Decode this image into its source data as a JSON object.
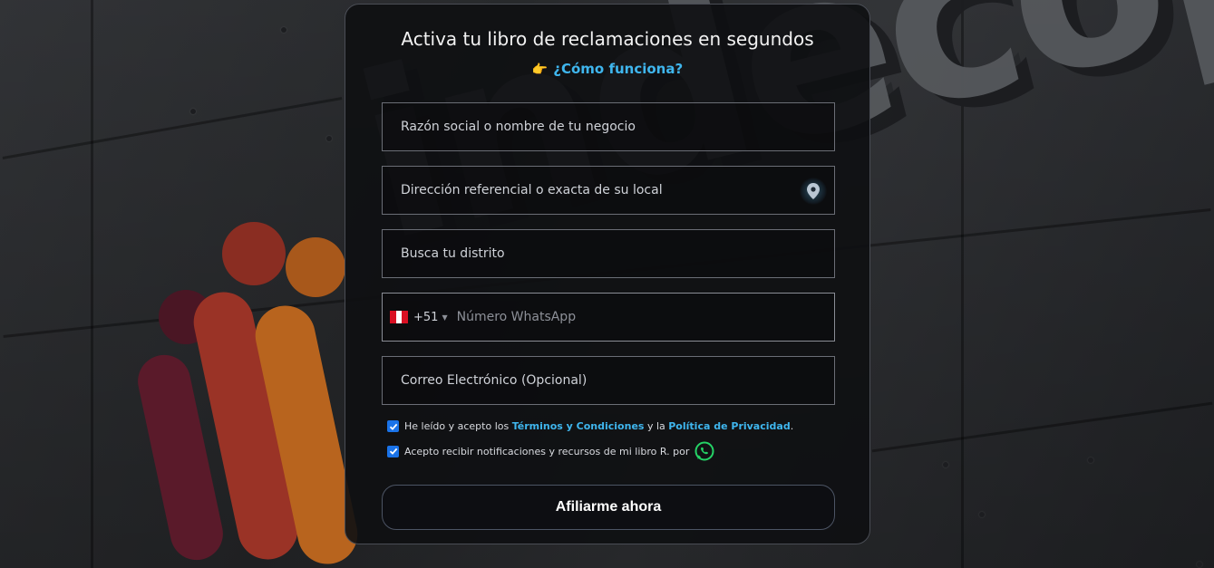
{
  "background": {
    "brand_text": "indecopi",
    "logo_colors": [
      "#5a1a2a",
      "#9a3326",
      "#b8641e"
    ]
  },
  "form": {
    "title": "Activa tu libro de reclamaciones en segundos",
    "how_link": "¿Cómo funciona?",
    "how_icon": "pointing-hand-icon",
    "fields": {
      "business_name": "Razón social o nombre de tu negocio",
      "address": "Dirección referencial o exacta de su local",
      "district": "Busca tu distrito",
      "phone_code": "+51",
      "phone_placeholder": "Número WhatsApp",
      "email": "Correo Electrónico (Opcional)"
    },
    "terms": {
      "checked": true,
      "prefix": "He leído y acepto los ",
      "terms_link": "Términos y Condiciones",
      "middle": " y la ",
      "privacy_link": "Política de Privacidad",
      "suffix": "."
    },
    "notifications": {
      "checked": true,
      "text": "Acepto recibir notificaciones y recursos de mi libro R. por"
    },
    "submit_label": "Afiliarme ahora"
  },
  "colors": {
    "accent_link": "#3fb6ee",
    "checkbox": "#1a73e8",
    "whatsapp": "#25d366"
  }
}
